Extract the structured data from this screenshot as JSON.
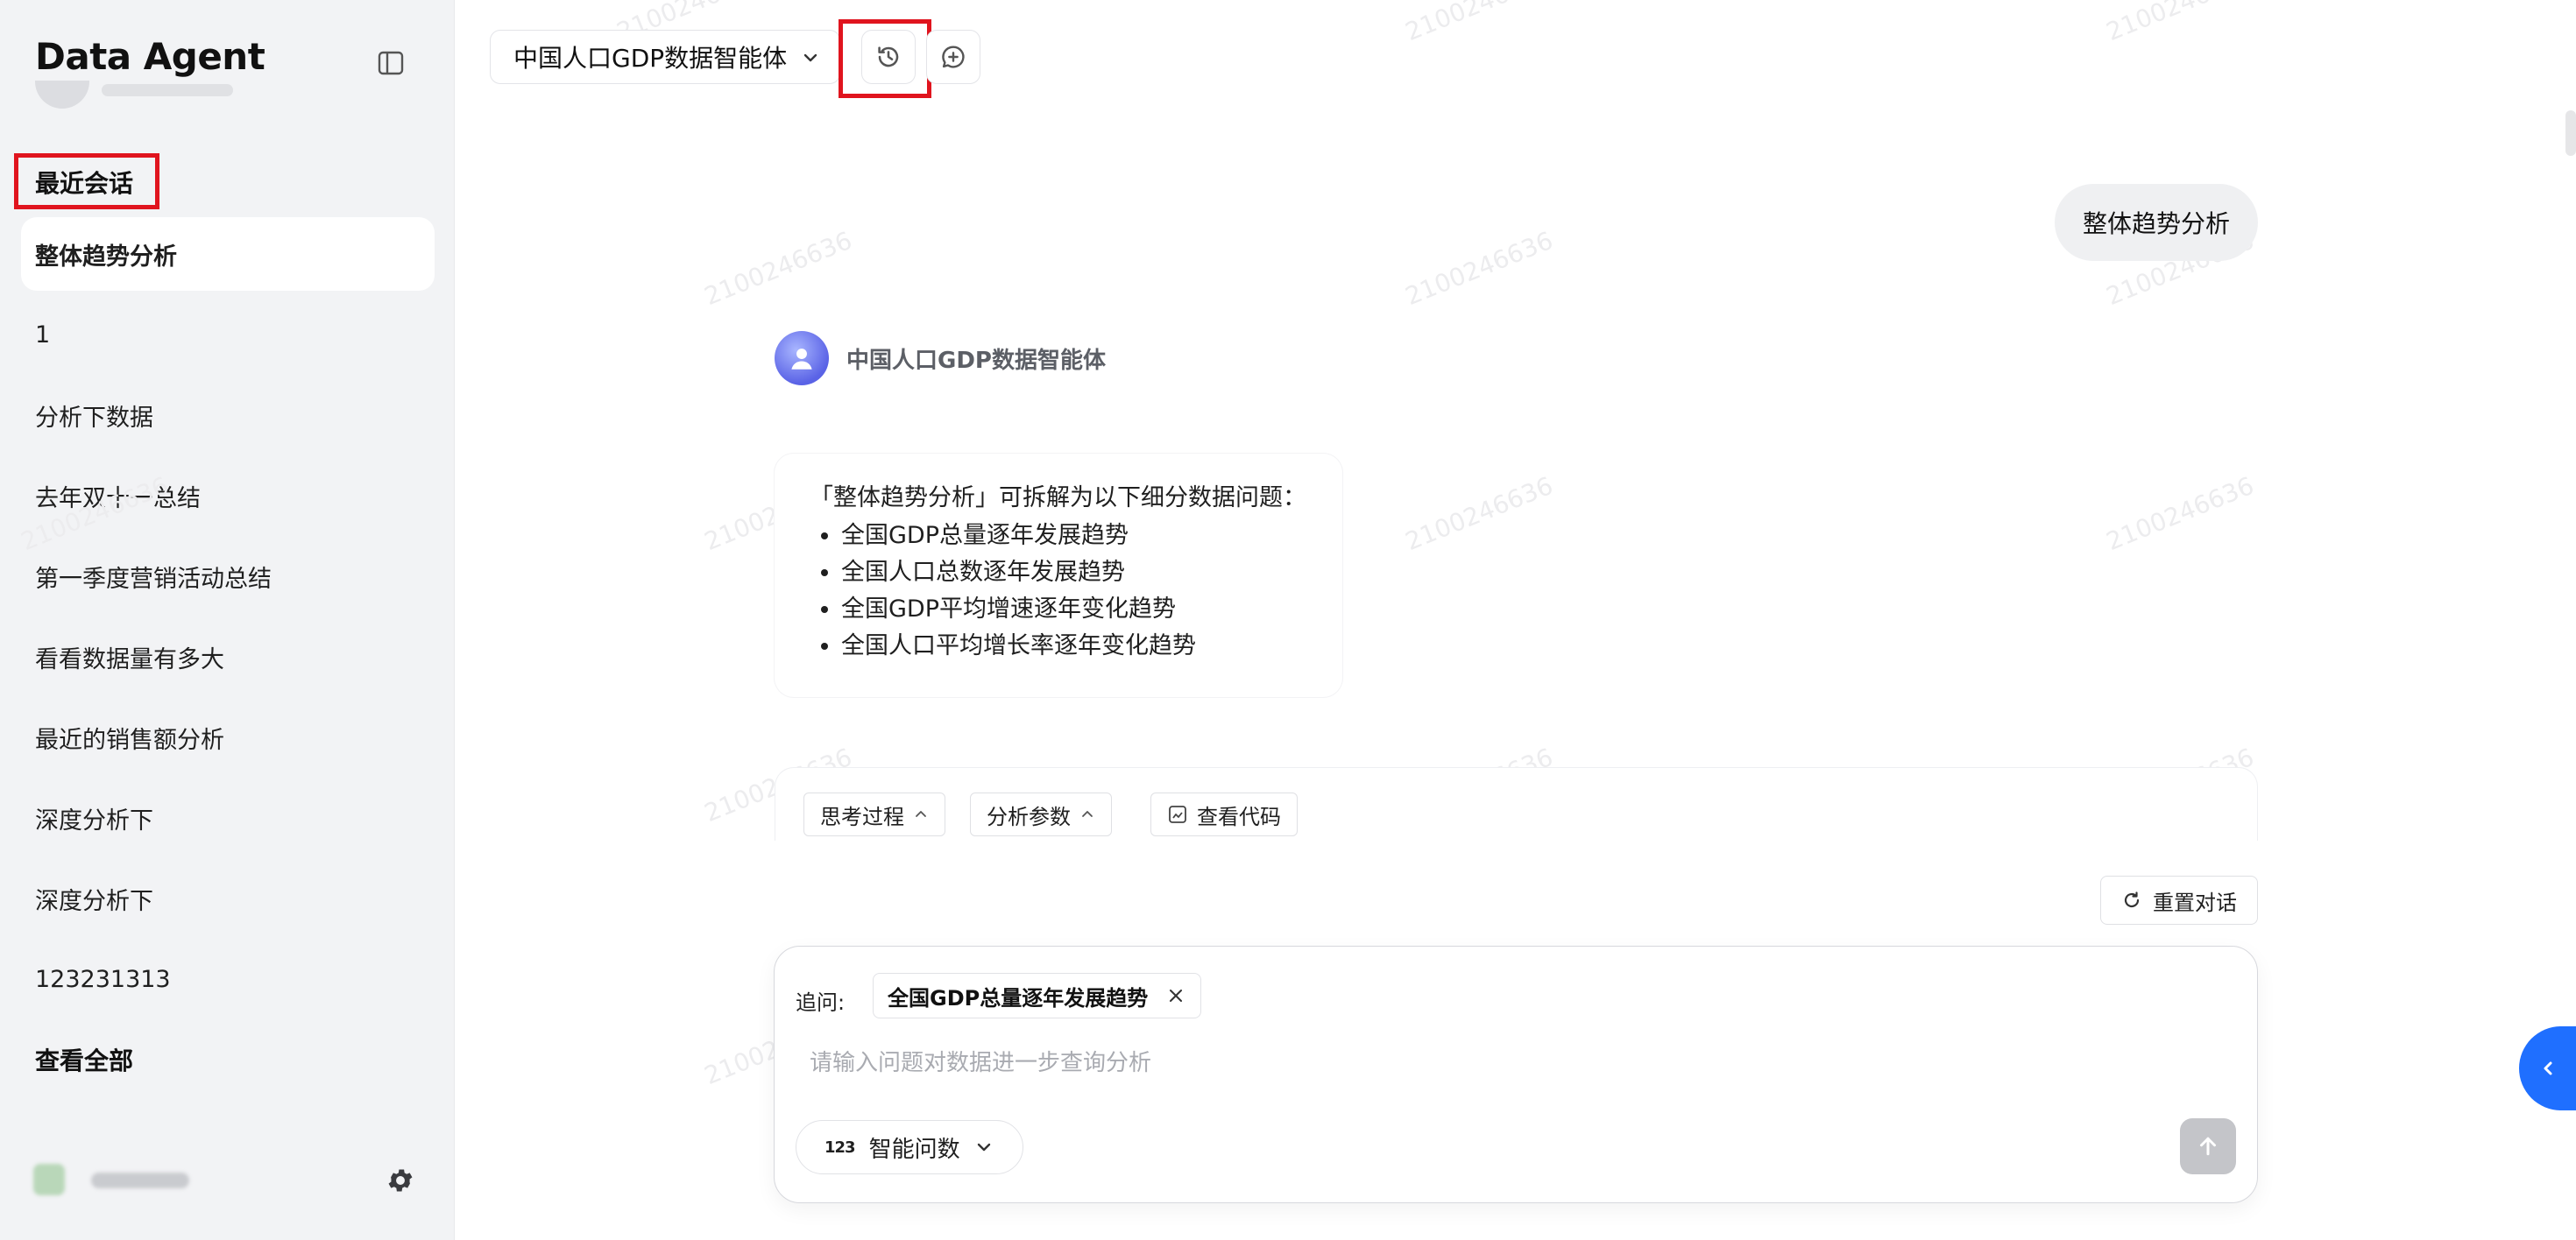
{
  "sidebar": {
    "brand": "Data Agent",
    "recent_title": "最近会话",
    "items": [
      {
        "label": "整体趋势分析",
        "active": true
      },
      {
        "label": "1"
      },
      {
        "label": "分析下数据"
      },
      {
        "label": "去年双十一总结"
      },
      {
        "label": "第一季度营销活动总结"
      },
      {
        "label": "看看数据量有多大"
      },
      {
        "label": "最近的销售额分析"
      },
      {
        "label": "深度分析下"
      },
      {
        "label": "深度分析下"
      },
      {
        "label": "123231313"
      }
    ],
    "view_all": "查看全部"
  },
  "header": {
    "agent_name": "中国人口GDP数据智能体"
  },
  "conversation": {
    "user_message": "整体趋势分析",
    "agent_name": "中国人口GDP数据智能体",
    "answer_intro": "「整体趋势分析」可拆解为以下细分数据问题：",
    "answer_items": [
      "全国GDP总量逐年发展趋势",
      "全国人口总数逐年发展趋势",
      "全国GDP平均增速逐年变化趋势",
      "全国人口平均增长率逐年变化趋势"
    ],
    "tools": {
      "thinking": "思考过程",
      "params": "分析参数",
      "code": "查看代码"
    },
    "reset": "重置对话"
  },
  "composer": {
    "followup_label": "追问:",
    "followup_chip": "全国GDP总量逐年发展趋势",
    "placeholder": "请输入问题对数据进一步查询分析",
    "mode_icon": "123",
    "mode_label": "智能问数"
  },
  "watermark": "2100246636",
  "colors": {
    "sidebar_bg": "#f2f3f5",
    "highlight_red": "#e0141e",
    "accent_blue": "#1f6fff",
    "send_disabled": "#c4c5c9"
  }
}
